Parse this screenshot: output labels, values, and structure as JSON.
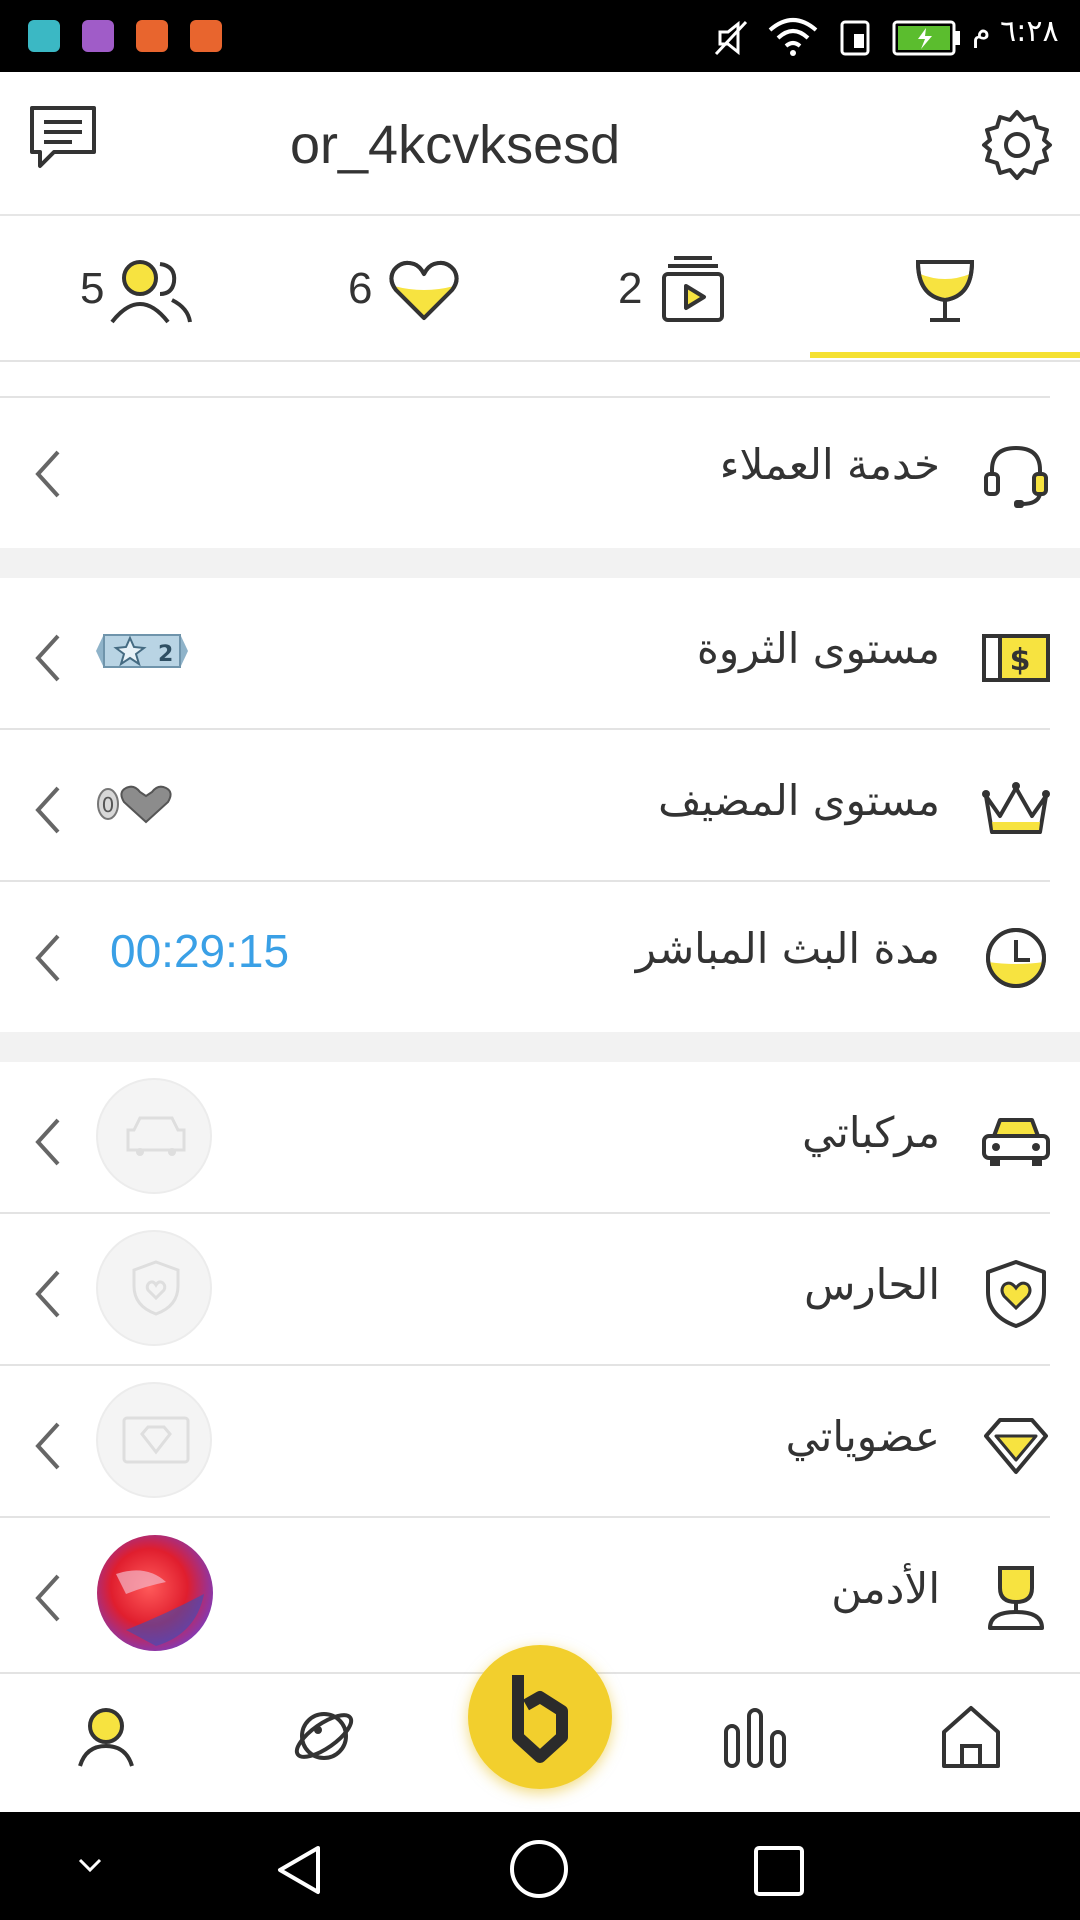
{
  "status_bar": {
    "time": "٦:٢٨ م",
    "apps": [
      "android-icon",
      "gallery-icon",
      "music-icon",
      "music-icon"
    ]
  },
  "header": {
    "username": "or_4kcvksesd",
    "left_icon": "chat-icon",
    "right_icon": "settings-gear-icon"
  },
  "tabs": [
    {
      "count": "5",
      "icon": "followers-icon"
    },
    {
      "count": "6",
      "icon": "heart-icon"
    },
    {
      "count": "2",
      "icon": "video-icon"
    },
    {
      "count": "",
      "icon": "trophy-icon",
      "active": true
    }
  ],
  "menu": {
    "customer_service": {
      "label": "خدمة العملاء",
      "icon": "headset-icon"
    },
    "wealth_level": {
      "label": "مستوى الثروة",
      "icon": "money-icon",
      "badge_value": "2"
    },
    "host_level": {
      "label": "مستوى المضيف",
      "icon": "crown-icon",
      "badge_value": "0"
    },
    "live_duration": {
      "label": "مدة البث المباشر",
      "icon": "clock-icon",
      "value": "00:29:15"
    },
    "vehicles": {
      "label": "مركباتي",
      "icon": "car-icon"
    },
    "guardian": {
      "label": "الحارس",
      "icon": "shield-heart-icon"
    },
    "memberships": {
      "label": "عضوياتي",
      "icon": "diamond-icon"
    },
    "admin": {
      "label": "الأدمن",
      "icon": "admin-icon"
    }
  },
  "bottom_nav": [
    "profile-icon",
    "planet-icon",
    "bigo-live-button",
    "ranking-icon",
    "home-icon"
  ],
  "colors": {
    "accent": "#f5e132",
    "duration": "#3aa0e6",
    "icon_fill": "#f7e340"
  }
}
